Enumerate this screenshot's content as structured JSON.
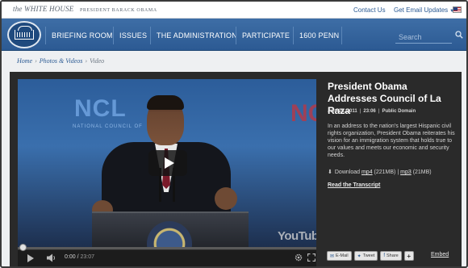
{
  "header": {
    "logo_text": "the WHITE HOUSE",
    "logo_subtext": "PRESIDENT BARACK OBAMA",
    "contact_label": "Contact Us",
    "email_updates_label": "Get Email Updates"
  },
  "nav": {
    "items": [
      "BRIEFING ROOM",
      "ISSUES",
      "THE ADMINISTRATION",
      "PARTICIPATE",
      "1600 PENN"
    ],
    "search_placeholder": "Search"
  },
  "breadcrumb": {
    "home": "Home",
    "section": "Photos & Videos",
    "current": "Video"
  },
  "video": {
    "backdrop_left": "NCL",
    "backdrop_left_sub": "NATIONAL COUNCIL OF",
    "backdrop_right": "NC",
    "watermark": "YouTube",
    "current_time": "0:00",
    "duration": "23:07",
    "progress": 0
  },
  "info": {
    "title": "President Obama Addresses Council of La Raza",
    "date": "July 25, 2011",
    "time": "23:06",
    "license": "Public Domain",
    "description": "In an address to the nation's largest Hispanic civil rights organization, President Obama reiterates his vision for an immigration system that holds true to our values and meets our economic and security needs.",
    "download_label": "Download",
    "mp4_label": "mp4",
    "mp4_size": "(221MB)",
    "mp3_label": "mp3",
    "mp3_size": "(21MB)",
    "transcript_label": "Read the Transcript"
  },
  "share": {
    "email_label": "E-Mail",
    "tweet_label": "Tweet",
    "share_label": "Share",
    "plus_label": "+",
    "embed_label": "Embed"
  },
  "colors": {
    "nav_blue": "#2c5a93",
    "panel_dark": "#2a2a2a",
    "link_blue": "#2b5a93"
  }
}
